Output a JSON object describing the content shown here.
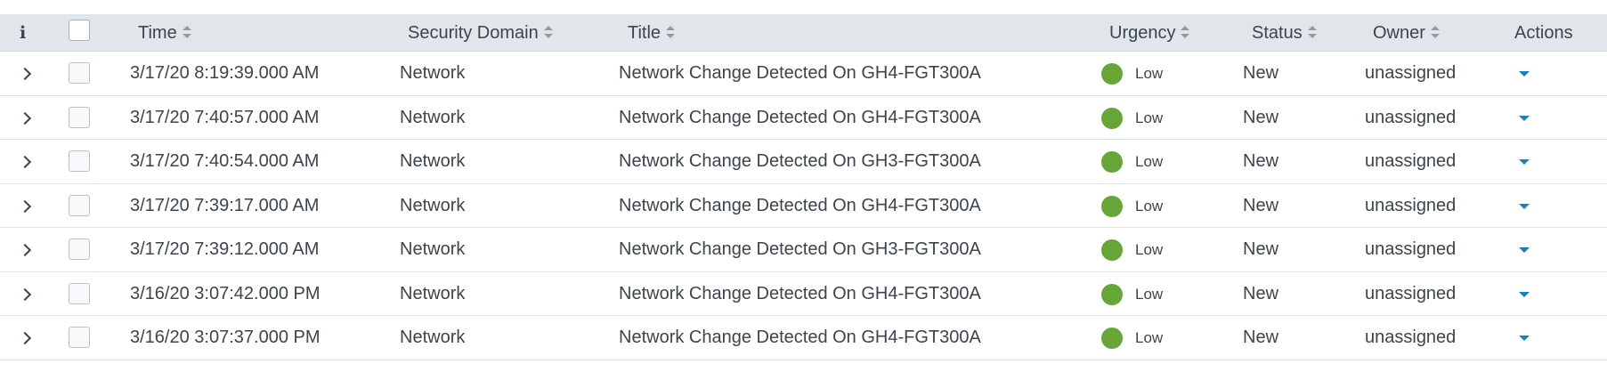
{
  "columns": {
    "time": "Time",
    "security_domain": "Security Domain",
    "title": "Title",
    "urgency": "Urgency",
    "status": "Status",
    "owner": "Owner",
    "actions": "Actions"
  },
  "info_icon_glyph": "i",
  "colors": {
    "header_bg": "#e1e6eb",
    "urgency_low": "#65a637",
    "action_caret": "#1a7fc1"
  },
  "rows": [
    {
      "time": "3/17/20 8:19:39.000 AM",
      "security_domain": "Network",
      "title": "Network Change Detected On GH4-FGT300A",
      "urgency": "Low",
      "status": "New",
      "owner": "unassigned"
    },
    {
      "time": "3/17/20 7:40:57.000 AM",
      "security_domain": "Network",
      "title": "Network Change Detected On GH4-FGT300A",
      "urgency": "Low",
      "status": "New",
      "owner": "unassigned"
    },
    {
      "time": "3/17/20 7:40:54.000 AM",
      "security_domain": "Network",
      "title": "Network Change Detected On GH3-FGT300A",
      "urgency": "Low",
      "status": "New",
      "owner": "unassigned"
    },
    {
      "time": "3/17/20 7:39:17.000 AM",
      "security_domain": "Network",
      "title": "Network Change Detected On GH4-FGT300A",
      "urgency": "Low",
      "status": "New",
      "owner": "unassigned"
    },
    {
      "time": "3/17/20 7:39:12.000 AM",
      "security_domain": "Network",
      "title": "Network Change Detected On GH3-FGT300A",
      "urgency": "Low",
      "status": "New",
      "owner": "unassigned"
    },
    {
      "time": "3/16/20 3:07:42.000 PM",
      "security_domain": "Network",
      "title": "Network Change Detected On GH4-FGT300A",
      "urgency": "Low",
      "status": "New",
      "owner": "unassigned"
    },
    {
      "time": "3/16/20 3:07:37.000 PM",
      "security_domain": "Network",
      "title": "Network Change Detected On GH4-FGT300A",
      "urgency": "Low",
      "status": "New",
      "owner": "unassigned"
    }
  ]
}
